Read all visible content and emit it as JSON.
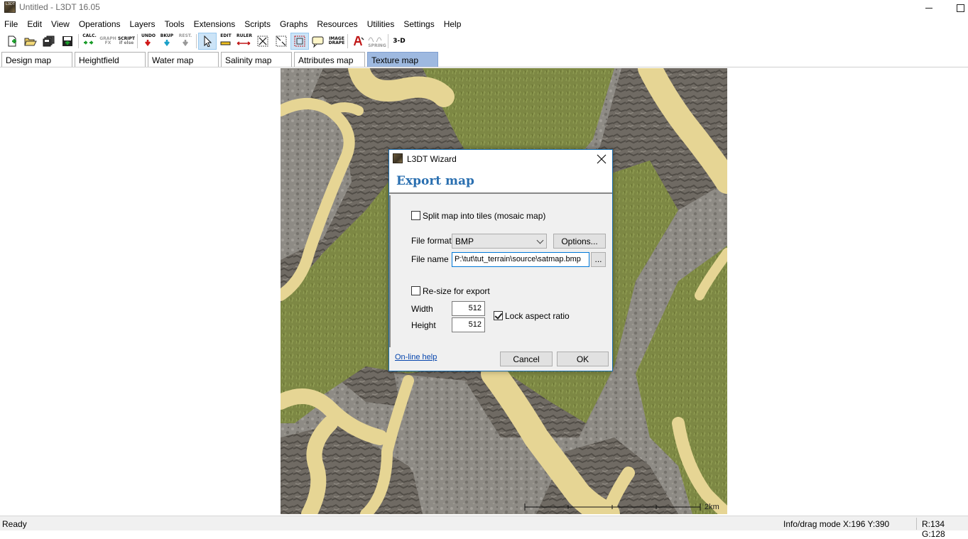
{
  "window": {
    "title": "Untitled - L3DT 16.05",
    "icon_text": "L3DT"
  },
  "menu": [
    "File",
    "Edit",
    "View",
    "Operations",
    "Layers",
    "Tools",
    "Extensions",
    "Scripts",
    "Graphs",
    "Resources",
    "Utilities",
    "Settings",
    "Help"
  ],
  "toolbar": {
    "calc": "CALC.",
    "graph_top": "GRAPH",
    "graph_bot": "FX",
    "script_top": "SCRIPT",
    "script_bot": "if else",
    "undo": "UNDO",
    "bkup": "BKUP",
    "rest": "REST.",
    "edit": "EDIT",
    "ruler": "RULER",
    "image": "IMAGE",
    "drape": "DRAPE",
    "spring": "SPRING",
    "three_d": "3-D"
  },
  "tabs": [
    {
      "label": "Design map",
      "active": false
    },
    {
      "label": "Heightfield",
      "active": false
    },
    {
      "label": "Water map",
      "active": false
    },
    {
      "label": "Salinity map",
      "active": false
    },
    {
      "label": "Attributes map",
      "active": false
    },
    {
      "label": "Texture map",
      "active": true
    }
  ],
  "map": {
    "scale_label": "2km"
  },
  "dialog": {
    "title": "L3DT Wizard",
    "heading": "Export map",
    "split_tiles": {
      "label": "Split map into tiles (mosaic map)",
      "checked": false
    },
    "file_format": {
      "label": "File format",
      "value": "BMP"
    },
    "options_button": "Options...",
    "file_name": {
      "label": "File name",
      "value": "P:\\tut\\tut_terrain\\source\\satmap.bmp"
    },
    "browse_button": "...",
    "resize": {
      "label": "Re-size for export",
      "checked": false
    },
    "width": {
      "label": "Width",
      "value": "512"
    },
    "height": {
      "label": "Height",
      "value": "512"
    },
    "lock_aspect": {
      "label": "Lock aspect ratio",
      "checked": true
    },
    "help_link": "On-line help",
    "cancel_button": "Cancel",
    "ok_button": "OK"
  },
  "status": {
    "ready": "Ready",
    "info": "Info/drag mode X:196 Y:390",
    "rg": "R:134 G:128"
  },
  "colors": {
    "accent": "#2a6fb0",
    "active_tab": "#9eb9e0",
    "sand": "#e6d594",
    "grass": "#7d8a45",
    "rock": "#8d8a83"
  }
}
